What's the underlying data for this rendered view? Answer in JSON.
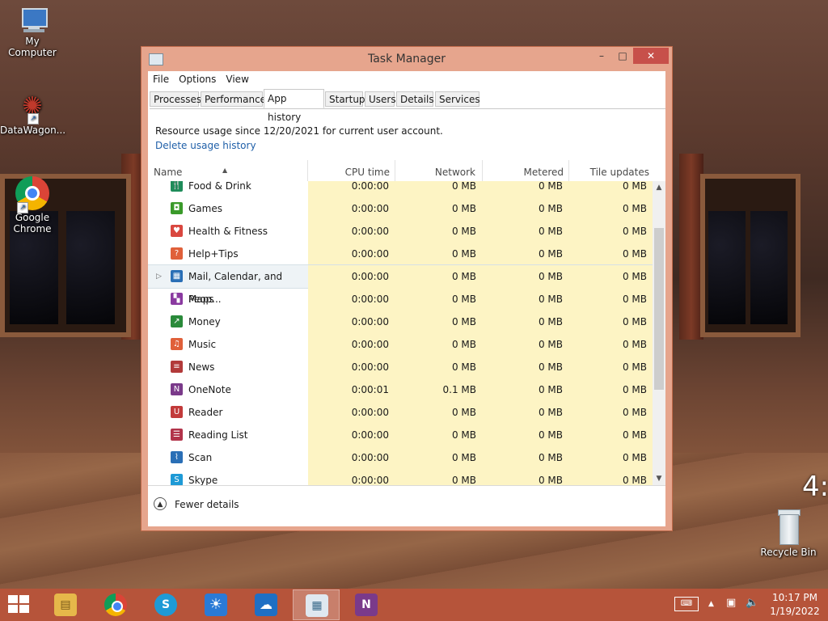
{
  "desktop": {
    "icons": [
      {
        "label": "My Computer"
      },
      {
        "label": "DataWagon..."
      },
      {
        "label": "Google Chrome"
      },
      {
        "label": "Recycle Bin"
      }
    ],
    "clock_overlay": "4:"
  },
  "window": {
    "title": "Task Manager",
    "controls": {
      "minimize": "–",
      "maximize": "□",
      "close": "✕"
    }
  },
  "menu": [
    "File",
    "Options",
    "View"
  ],
  "tabs": [
    "Processes",
    "Performance",
    "App history",
    "Startup",
    "Users",
    "Details",
    "Services"
  ],
  "active_tab": "App history",
  "app_history": {
    "since_text": "Resource usage since 12/20/2021 for current user account.",
    "delete_link": "Delete usage history",
    "columns": [
      "Name",
      "CPU time",
      "Network",
      "Metered network",
      "Tile updates"
    ],
    "rows": [
      {
        "name": "Food & Drink",
        "cpu": "0:00:00",
        "network": "0 MB",
        "metered": "0 MB",
        "tile": "0 MB",
        "icon": "fork-knife-icon",
        "color": "#1e8c5a"
      },
      {
        "name": "Games",
        "cpu": "0:00:00",
        "network": "0 MB",
        "metered": "0 MB",
        "tile": "0 MB",
        "icon": "gamepad-icon",
        "color": "#3a9a2a"
      },
      {
        "name": "Health & Fitness",
        "cpu": "0:00:00",
        "network": "0 MB",
        "metered": "0 MB",
        "tile": "0 MB",
        "icon": "heart-icon",
        "color": "#d9473f"
      },
      {
        "name": "Help+Tips",
        "cpu": "0:00:00",
        "network": "0 MB",
        "metered": "0 MB",
        "tile": "0 MB",
        "icon": "question-icon",
        "color": "#e0603a"
      },
      {
        "name": "Mail, Calendar, and Peop...",
        "cpu": "0:00:00",
        "network": "0 MB",
        "metered": "0 MB",
        "tile": "0 MB",
        "icon": "mail-calendar-icon",
        "color": "#2a6fb6"
      },
      {
        "name": "Maps",
        "cpu": "0:00:00",
        "network": "0 MB",
        "metered": "0 MB",
        "tile": "0 MB",
        "icon": "map-icon",
        "color": "#8a3aa0"
      },
      {
        "name": "Money",
        "cpu": "0:00:00",
        "network": "0 MB",
        "metered": "0 MB",
        "tile": "0 MB",
        "icon": "chart-up-icon",
        "color": "#2a8a3a"
      },
      {
        "name": "Music",
        "cpu": "0:00:00",
        "network": "0 MB",
        "metered": "0 MB",
        "tile": "0 MB",
        "icon": "headphones-icon",
        "color": "#e0603a"
      },
      {
        "name": "News",
        "cpu": "0:00:00",
        "network": "0 MB",
        "metered": "0 MB",
        "tile": "0 MB",
        "icon": "newspaper-icon",
        "color": "#b23a3a"
      },
      {
        "name": "OneNote",
        "cpu": "0:00:01",
        "network": "0.1 MB",
        "metered": "0 MB",
        "tile": "0 MB",
        "icon": "onenote-icon",
        "color": "#7a3a8a"
      },
      {
        "name": "Reader",
        "cpu": "0:00:00",
        "network": "0 MB",
        "metered": "0 MB",
        "tile": "0 MB",
        "icon": "reader-icon",
        "color": "#c23a3a"
      },
      {
        "name": "Reading List",
        "cpu": "0:00:00",
        "network": "0 MB",
        "metered": "0 MB",
        "tile": "0 MB",
        "icon": "reading-list-icon",
        "color": "#b2334a"
      },
      {
        "name": "Scan",
        "cpu": "0:00:00",
        "network": "0 MB",
        "metered": "0 MB",
        "tile": "0 MB",
        "icon": "scan-icon",
        "color": "#2a6fb6"
      },
      {
        "name": "Skype",
        "cpu": "0:00:00",
        "network": "0 MB",
        "metered": "0 MB",
        "tile": "0 MB",
        "icon": "skype-icon",
        "color": "#1e9ad6"
      }
    ],
    "selected_row": "Mail, Calendar, and Peop..."
  },
  "footer": {
    "label": "Fewer details"
  },
  "taskbar": {
    "apps": [
      "file-explorer-icon",
      "chrome-icon",
      "skype-icon",
      "weather-icon",
      "onedrive-icon",
      "task-manager-icon",
      "onenote-icon"
    ],
    "time": "10:17 PM",
    "date": "1/19/2022"
  }
}
